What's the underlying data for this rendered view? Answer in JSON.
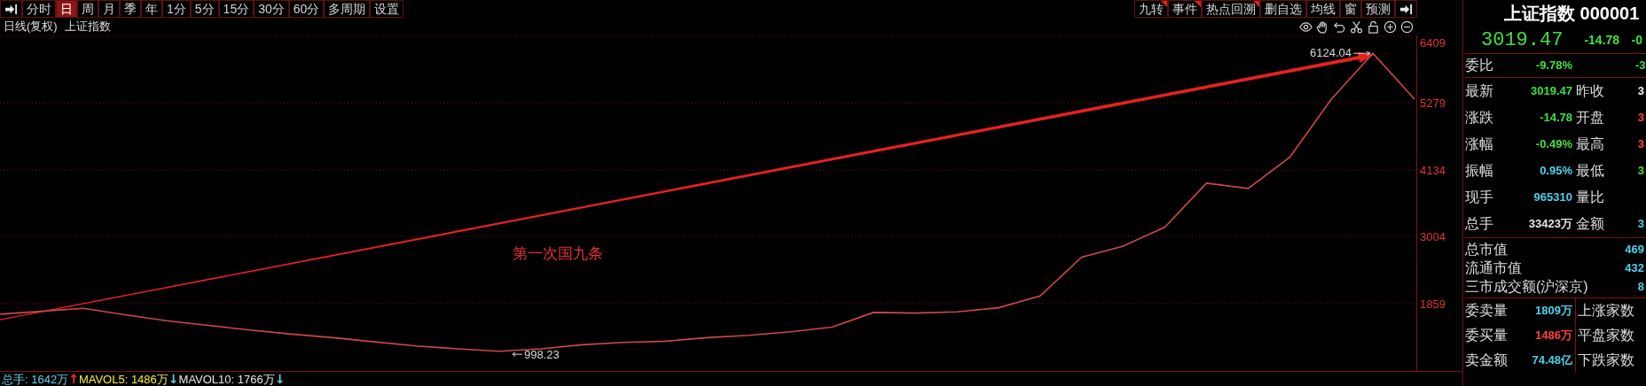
{
  "period_toolbar": [
    {
      "label": "分时",
      "selected": false
    },
    {
      "label": "日",
      "selected": true
    },
    {
      "label": "周",
      "selected": false
    },
    {
      "label": "月",
      "selected": false
    },
    {
      "label": "季",
      "selected": false
    },
    {
      "label": "年",
      "selected": false
    },
    {
      "label": "1分",
      "selected": false
    },
    {
      "label": "5分",
      "selected": false
    },
    {
      "label": "15分",
      "selected": false
    },
    {
      "label": "30分",
      "selected": false
    },
    {
      "label": "60分",
      "selected": false
    },
    {
      "label": "多周期",
      "selected": false
    },
    {
      "label": "设置",
      "selected": false
    }
  ],
  "tool_toolbar": [
    {
      "label": "九转",
      "flagged": true
    },
    {
      "label": "事件",
      "flagged": true
    },
    {
      "label": "热点回溯",
      "flagged": true
    },
    {
      "label": "删自选",
      "flagged": false
    },
    {
      "label": "均线",
      "flagged": false
    },
    {
      "label": "窗",
      "flagged": false
    },
    {
      "label": "预测",
      "flagged": false
    }
  ],
  "chart": {
    "period_label": "日线(复权)",
    "instrument": "上证指数",
    "high_label": "6124.04",
    "low_label": "998.23",
    "annotation": "第一次国九条",
    "chart_data": {
      "type": "line",
      "grid": true,
      "ylim": [
        714,
        6424
      ],
      "yticks": [
        6409,
        5279,
        4134,
        3004,
        1859
      ],
      "values": [
        1680,
        1730,
        1780,
        1670,
        1570,
        1490,
        1410,
        1340,
        1280,
        1210,
        1140,
        1090,
        1050,
        1090,
        1160,
        1200,
        1220,
        1280,
        1320,
        1380,
        1460,
        1710,
        1700,
        1720,
        1790,
        1990,
        2650,
        2840,
        3160,
        3910,
        3820,
        4350,
        5340,
        6120,
        5340
      ]
    }
  },
  "volume_legend": [
    {
      "text": "总手: 1642万",
      "color": "#5fd3ee"
    },
    {
      "text": "↑",
      "color": "#ff3030"
    },
    {
      "text": "MAVOL5: 1486万",
      "color": "#f5f032"
    },
    {
      "text": "↓",
      "color": "#5fd3ee"
    },
    {
      "text": "MAVOL10: 1766万",
      "color": "#e6e6e6"
    },
    {
      "text": "↓",
      "color": "#5fd3ee"
    }
  ],
  "quote_panel": {
    "name": "上证指数",
    "code": "000001",
    "price": "3019.47",
    "change": "-14.78",
    "change_pct": "-0",
    "color": "#3ee03e",
    "ratio": {
      "label": "委比",
      "value": "-9.78%",
      "extra": "-3",
      "color": "#3ee03e"
    },
    "quotes": [
      {
        "cells": [
          {
            "label": "最新",
            "value": "3019.47",
            "color": "#3ee03e"
          },
          {
            "label": "昨收",
            "value": "3",
            "color": "#f0f0f0"
          }
        ]
      },
      {
        "cells": [
          {
            "label": "涨跌",
            "value": "-14.78",
            "color": "#3ee03e"
          },
          {
            "label": "开盘",
            "value": "3",
            "color": "#ff4040"
          }
        ]
      },
      {
        "cells": [
          {
            "label": "涨幅",
            "value": "-0.49%",
            "color": "#3ee03e"
          },
          {
            "label": "最高",
            "value": "3",
            "color": "#ff4040"
          }
        ]
      },
      {
        "cells": [
          {
            "label": "振幅",
            "value": "0.95%",
            "color": "#4fd0ea"
          },
          {
            "label": "最低",
            "value": "3",
            "color": "#3ee03e"
          }
        ]
      },
      {
        "cells": [
          {
            "label": "现手",
            "value": "965310",
            "color": "#4fd0ea"
          },
          {
            "label": "量比"
          }
        ]
      },
      {
        "cells": [
          {
            "label": "总手",
            "value": "33423万",
            "color": "#e6e6e6"
          },
          {
            "label": "金额",
            "value": "3",
            "color": "#4fd0ea"
          }
        ]
      }
    ],
    "market": [
      {
        "label": "总市值",
        "value": "469"
      },
      {
        "label": "流通市值",
        "value": "432"
      },
      {
        "label": "三市成交额(沪深京)",
        "value": "8"
      }
    ],
    "orders": [
      {
        "label": "委卖量",
        "value": "1809万",
        "color": "#4fd0ea",
        "label2": "上涨家数"
      },
      {
        "label": "委买量",
        "value": "1486万",
        "color": "#ff4040",
        "label2": "平盘家数"
      },
      {
        "label": "卖金额",
        "value": "74.48亿",
        "color": "#4fd0ea",
        "label2": "下跌家数"
      }
    ]
  }
}
